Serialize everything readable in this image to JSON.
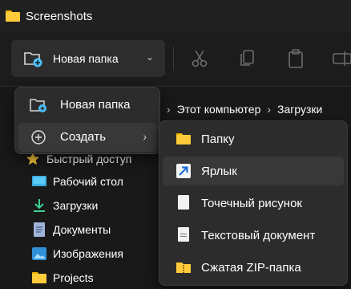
{
  "window": {
    "title": "Screenshots"
  },
  "toolbar": {
    "new_button_label": "Новая папка",
    "icons": [
      "cut-icon",
      "copy-icon",
      "paste-icon",
      "rename-icon"
    ]
  },
  "address_bar": {
    "crumbs": [
      "Этот компьютер",
      "Загрузки"
    ]
  },
  "sidebar": {
    "items": [
      {
        "label": "Быстрый доступ",
        "icon": "star-icon"
      },
      {
        "label": "Рабочий стол",
        "icon": "desktop-icon"
      },
      {
        "label": "Загрузки",
        "icon": "download-icon"
      },
      {
        "label": "Документы",
        "icon": "documents-icon"
      },
      {
        "label": "Изображения",
        "icon": "pictures-icon"
      },
      {
        "label": "Projects",
        "icon": "folder-icon"
      }
    ]
  },
  "new_menu": {
    "items": [
      {
        "label": "Новая папка",
        "icon": "new-folder-icon"
      },
      {
        "label": "Создать",
        "icon": "plus-circle-icon",
        "has_submenu": true
      }
    ]
  },
  "create_submenu": {
    "items": [
      {
        "label": "Папку",
        "icon": "folder-icon"
      },
      {
        "label": "Ярлык",
        "icon": "shortcut-icon"
      },
      {
        "label": "Точечный рисунок",
        "icon": "bitmap-file-icon"
      },
      {
        "label": "Текстовый документ",
        "icon": "text-file-icon"
      },
      {
        "label": "Сжатая ZIP-папка",
        "icon": "zip-folder-icon"
      }
    ]
  },
  "colors": {
    "background": "#191919",
    "menu": "#2c2c2c",
    "hover": "#383838",
    "folder": "#ffcb3a",
    "accent": "#4cc2ff"
  }
}
